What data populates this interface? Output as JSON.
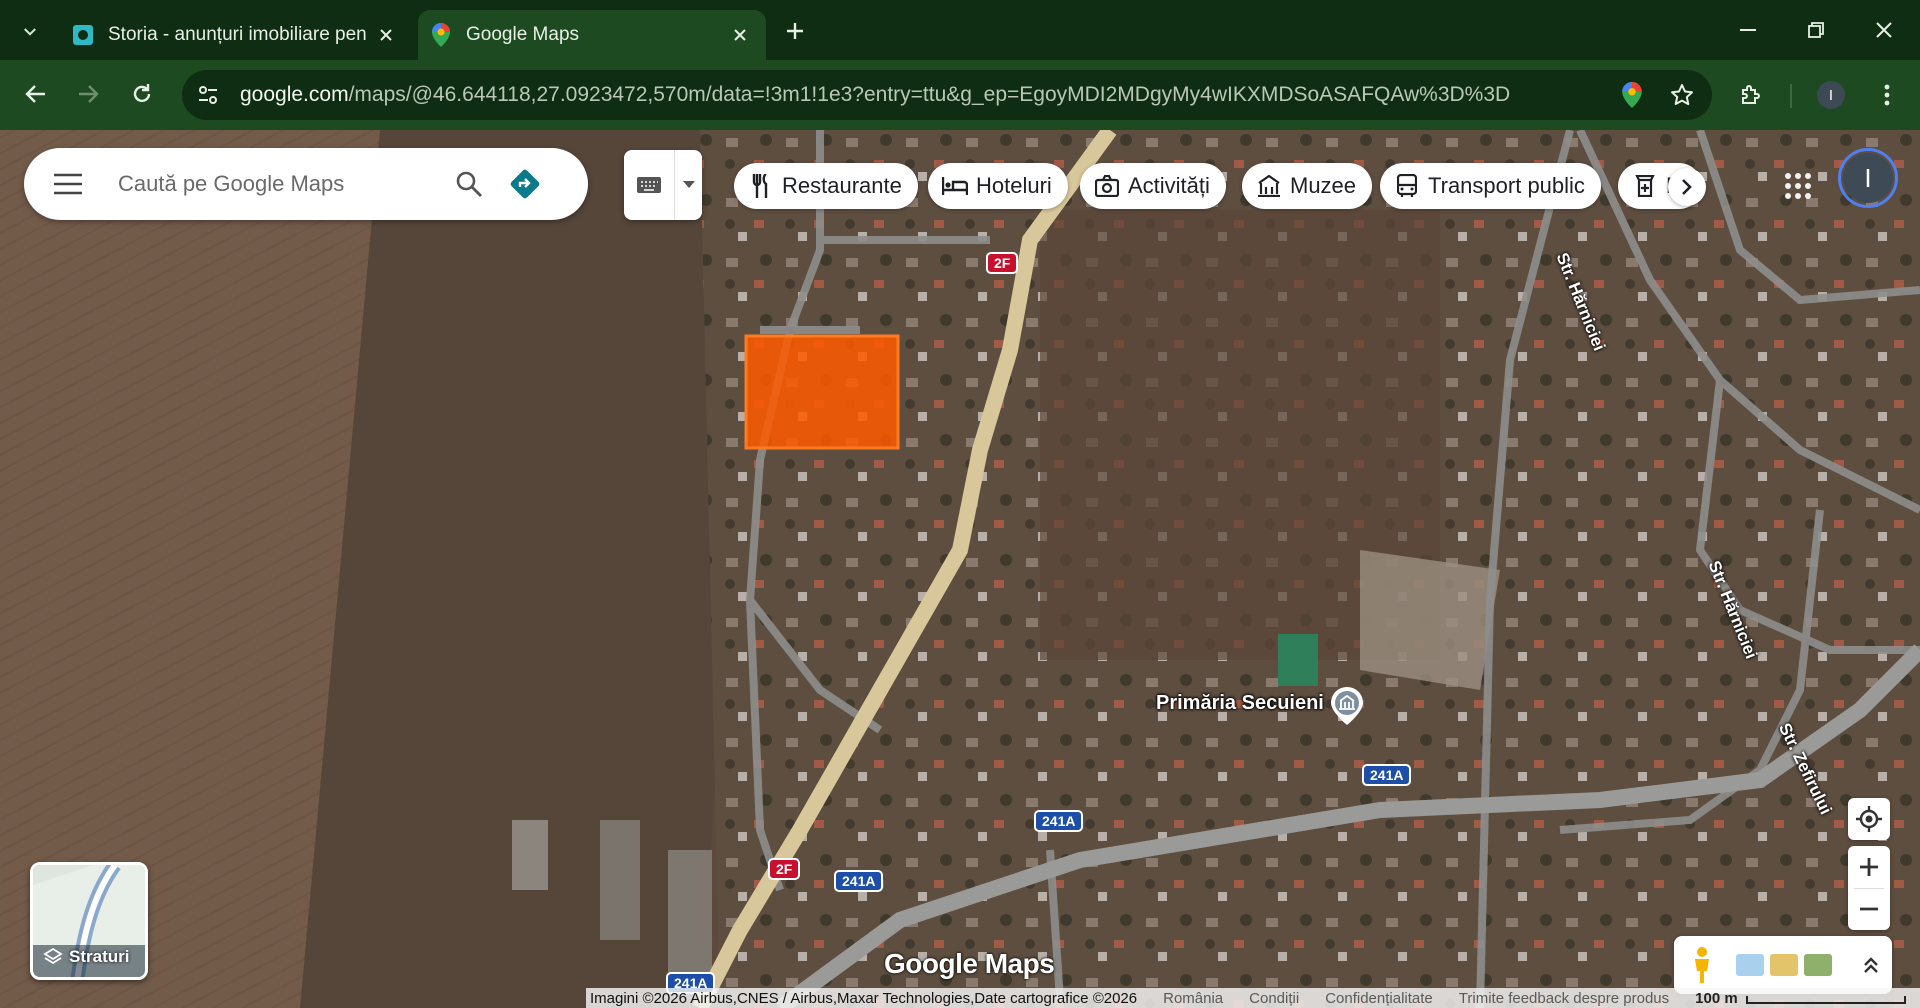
{
  "browser": {
    "tabs": [
      {
        "title": "Storia - anunțuri imobiliare pen",
        "active": false
      },
      {
        "title": "Google Maps",
        "active": true
      }
    ],
    "url_host": "google.com",
    "url_path": "/maps/@46.644118,27.0923472,570m/data=!3m1!1e3?entry=ttu&g_ep=EgoyMDI2MDgyMy4wIKXMDSoASAFQAw%3D%3D",
    "profile_initial": "I"
  },
  "search": {
    "placeholder": "Caută pe Google Maps"
  },
  "chips": [
    {
      "label": "Restaurante",
      "icon": "fork-knife-icon"
    },
    {
      "label": "Hoteluri",
      "icon": "bed-icon"
    },
    {
      "label": "Activități",
      "icon": "camera-icon"
    },
    {
      "label": "Muzee",
      "icon": "museum-icon"
    },
    {
      "label": "Transport public",
      "icon": "bus-icon"
    },
    {
      "label": "F",
      "icon": "pharmacy-icon"
    }
  ],
  "account": {
    "initial": "I"
  },
  "map": {
    "streets": [
      "Str. Hărniciei",
      "Str. Hărniciei",
      "Str. Zefirului"
    ],
    "place": "Primăria Secuieni",
    "shields": [
      "2F",
      "2F",
      "241A",
      "241A",
      "241A",
      "241A"
    ],
    "highlight_color": "#ff5a00",
    "watermark": ""
  },
  "layers": {
    "label": "Straturi"
  },
  "logo": "Google Maps",
  "footer": {
    "attribution": "Imagini ©2026 Airbus,CNES / Airbus,Maxar Technologies,Date cartografice ©2026",
    "links": [
      "România",
      "Condiții",
      "Confidențialitate",
      "Trimite feedback despre produs"
    ],
    "scale": "100 m"
  },
  "colors": {
    "chrome_dark": "#0f2d12",
    "chrome_toolbar": "#1e4a22",
    "accent_blue": "#4f7ff0",
    "directions_teal": "#0b7a8a"
  }
}
